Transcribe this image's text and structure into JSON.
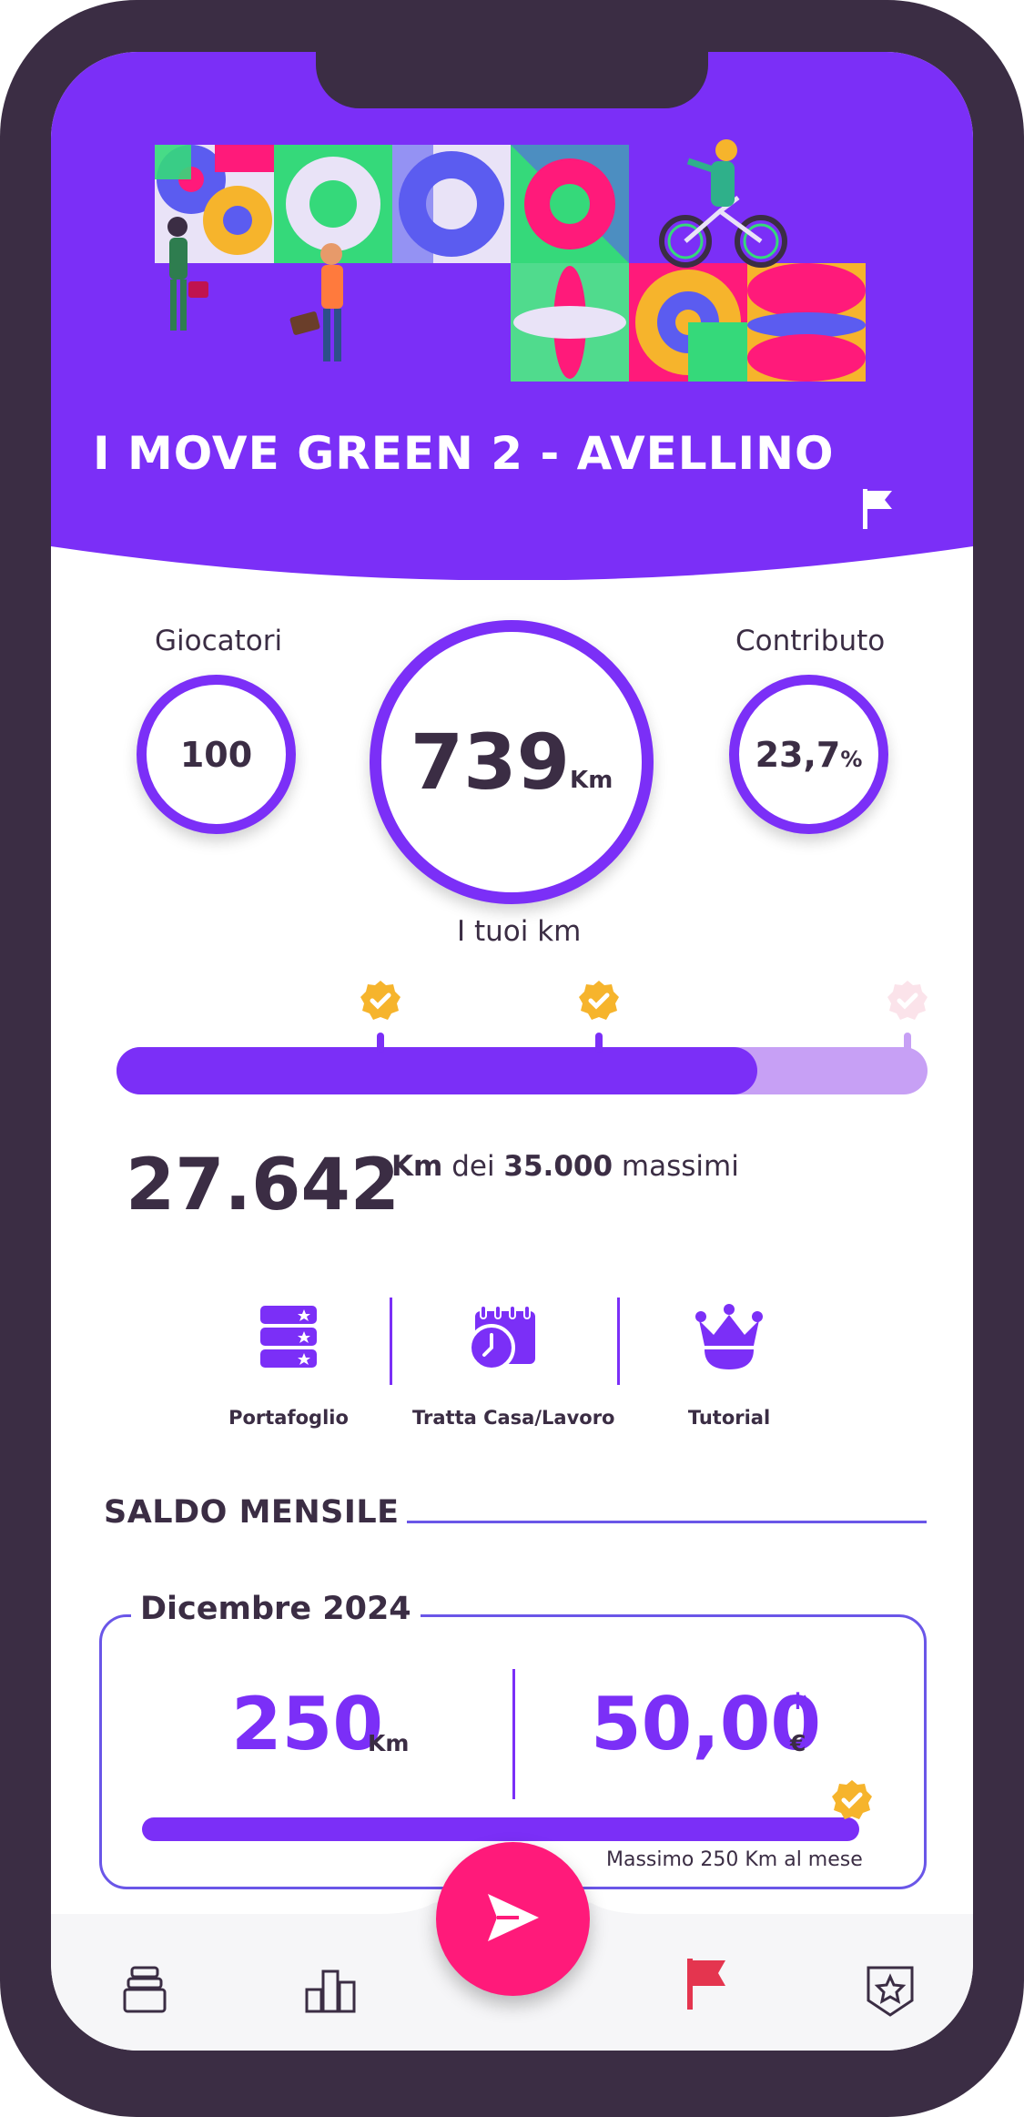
{
  "challenge": {
    "title": "I MOVE GREEN 2 - AVELLINO"
  },
  "stats": {
    "players_label": "Giocatori",
    "players_value": "100",
    "km_value": "739",
    "km_unit": "Km",
    "km_label": "I tuoi km",
    "contribution_label": "Contributo",
    "contribution_value": "23,7",
    "contribution_unit": "%"
  },
  "progress": {
    "fraction": 0.79,
    "total_value": "27.642",
    "unit_label": "Km",
    "of_label": "dei",
    "max_value": "35.000",
    "max_label": "massimi",
    "milestones_reached": [
      true,
      true,
      false
    ]
  },
  "quick_actions": [
    {
      "label": "Portafoglio",
      "icon": "wallet-stack-icon"
    },
    {
      "label": "Tratta Casa/Lavoro",
      "icon": "calendar-clock-icon"
    },
    {
      "label": "Tutorial",
      "icon": "crown-icon"
    }
  ],
  "monthly": {
    "section_title": "SALDO MENSILE",
    "month": "Dicembre 2024",
    "km_value": "250",
    "km_unit": "Km",
    "money_value": "50,00",
    "money_star": "*",
    "money_unit": "€",
    "max_note": "Massimo 250 Km al mese",
    "fraction": 1.0
  },
  "tabbar": [
    {
      "icon": "wallet-icon"
    },
    {
      "icon": "leaderboard-icon"
    },
    {
      "icon": "send-icon"
    },
    {
      "icon": "flag-icon",
      "active": true
    },
    {
      "icon": "badge-star-icon"
    }
  ],
  "colors": {
    "primary": "#7b2ff7",
    "text": "#3b2d44",
    "accent": "#ff1a7a",
    "milestone": "#f6b42c",
    "active_tab": "#e4354f"
  }
}
